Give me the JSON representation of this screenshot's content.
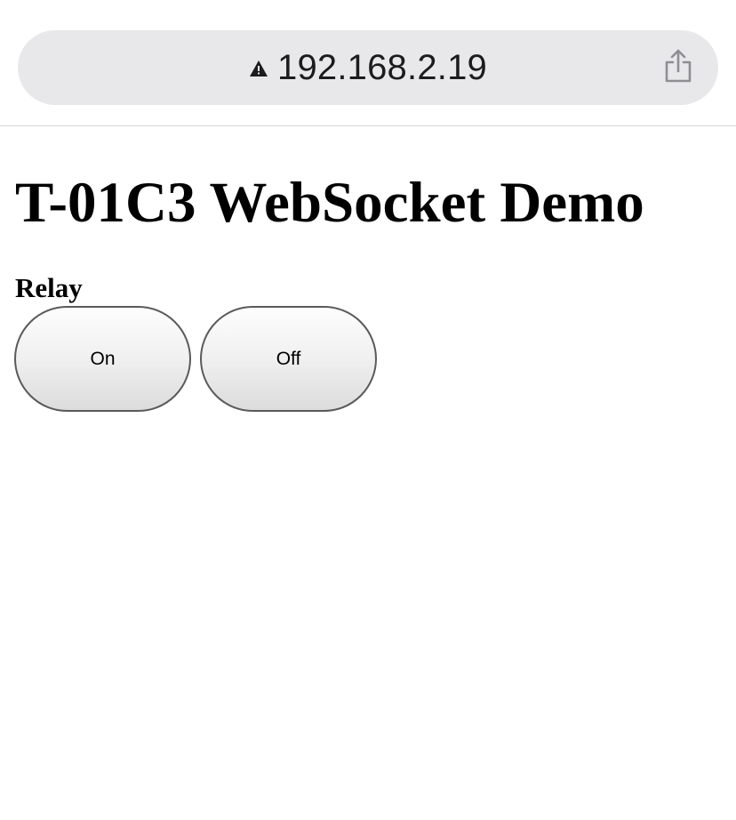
{
  "browser": {
    "url": "192.168.2.19",
    "security_icon": "warning-triangle-icon",
    "share_icon": "share-icon"
  },
  "page": {
    "title": "T-01C3 WebSocket Demo",
    "section_label": "Relay",
    "buttons": {
      "on_label": "On",
      "off_label": "Off"
    }
  }
}
